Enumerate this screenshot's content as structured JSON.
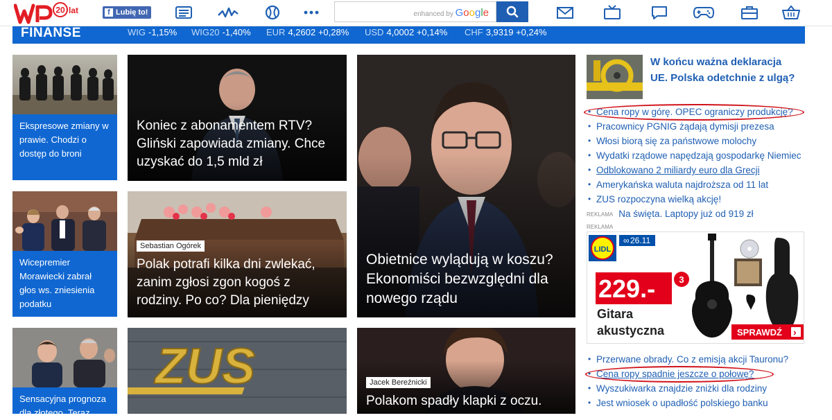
{
  "header": {
    "logo_text": "WP",
    "logo_badge": "20",
    "logo_badge_suffix": "lat",
    "fb_label": "Lubię to!",
    "search": {
      "placeholder": "",
      "brand_small": "enhanced by",
      "brand_google": "Google"
    },
    "icons": [
      "news-icon",
      "pulse-icon",
      "sport-ball-icon",
      "more-dots-icon",
      "mail-icon",
      "tv-icon",
      "chat-icon",
      "gamepad-icon",
      "briefcase-icon",
      "basket-icon"
    ]
  },
  "finance": {
    "label": "FINANSE",
    "tickers": [
      {
        "name": "WIG",
        "value": "-1,15%"
      },
      {
        "name": "WIG20",
        "value": "-1,40%"
      },
      {
        "name": "EUR",
        "value": "4,2602 +0,28%"
      },
      {
        "name": "USD",
        "value": "4,0002 +0,14%"
      },
      {
        "name": "CHF",
        "value": "3,9319 +0,24%"
      }
    ]
  },
  "small_tiles": [
    {
      "caption": "Ekspresowe zmiany w prawie. Chodzi o dostęp do broni"
    },
    {
      "caption": "Wicepremier Morawiecki zabrał głos ws. zniesienia podatku"
    },
    {
      "caption": "Sensacyjna prognoza dla złotego. Teraz"
    }
  ],
  "tiles": [
    {
      "title": "Koniec z abonamentem RTV? Gliński zapowiada zmiany. Chce uzyskać do 1,5 mld zł"
    },
    {
      "author": "Sebastian Ogórek",
      "title": "Polak potrafi kilka dni zwlekać, zanim zgłosi zgon kogoś z rodziny. Po co? Dla pieniędzy"
    },
    {
      "title": "Obietnice wylądują w koszu? Ekonomiści bezwzględni dla nowego rządu"
    },
    {
      "logo_text": "ZUS"
    },
    {
      "author": "Jacek Bereźnicki",
      "title": "Polakom spadły klapki z oczu."
    }
  ],
  "right": {
    "lead": "W końcu ważna deklaracja UE. Polska odetchnie z ulgą?",
    "list1": [
      "Cena ropy w górę. OPEC ograniczy produkcję?",
      "Pracownicy PGNIG żądają dymisji prezesa",
      "Włosi biorą się za państwowe molochy",
      "Wydatki rządowe napędzają gospodarkę Niemiec",
      "Odblokowano 2 miliardy euro dla Grecji",
      "Amerykańska waluta najdroższa od 11 lat",
      "ZUS rozpoczyna wielką akcję!"
    ],
    "ad_tag": "REKLAMA",
    "ad_line": "Na święta. Laptopy już od 919 zł",
    "ad_label": "REKLAMA",
    "ad": {
      "brand": "LIDL",
      "date": "26.11",
      "date_prefix": "∞",
      "price": "229.-",
      "badge": "3",
      "product": "Gitara akustyczna",
      "cta": "SPRAWDŹ",
      "cta_arrow": "›"
    },
    "list2": [
      "Przerwane obrady. Co z emisją akcji Tauronu?",
      "Cena ropy spadnie jeszcze o połowę?",
      "Wyszukiwarka znajdzie zniżki dla rodziny",
      "Jest wniosek o upadłość polskiego banku"
    ]
  },
  "colors": {
    "brand_blue": "#1067d1",
    "link_blue": "#1f5fb3",
    "logo_red": "#e21d24",
    "oval_red": "#d0121a"
  }
}
